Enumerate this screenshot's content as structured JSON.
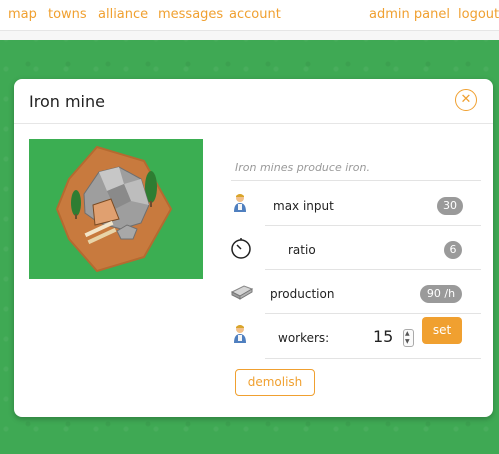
{
  "nav": {
    "map": "map",
    "towns": "towns",
    "alliance": "alliance",
    "messages": "messages",
    "account": "account",
    "admin_panel": "admin panel",
    "logout": "logout"
  },
  "modal": {
    "title": "Iron mine",
    "close_symbol": "✕",
    "description": "Iron mines produce iron.",
    "max_input": {
      "label": "max input",
      "value": "30",
      "icon": "worker-icon"
    },
    "ratio": {
      "label": "ratio",
      "value": "6",
      "icon": "timer-icon"
    },
    "production": {
      "label": "production",
      "value": "90 /h",
      "icon": "iron-bar-icon"
    },
    "workers": {
      "label": "workers:",
      "value": "15",
      "icon": "worker-icon"
    },
    "set_label": "set",
    "demolish_label": "demolish"
  },
  "colors": {
    "accent": "#f0a030",
    "grass": "#3fa954",
    "badge": "#9a9a9a"
  }
}
